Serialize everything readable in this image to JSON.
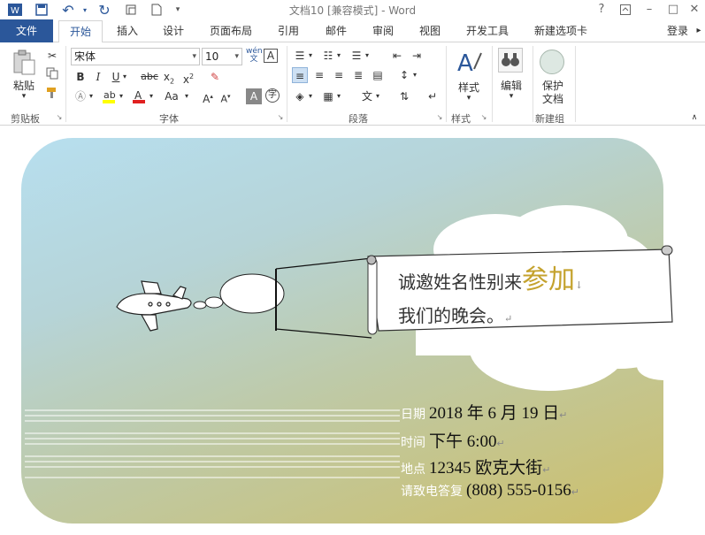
{
  "app": {
    "title": "文档10 [兼容模式] - Word",
    "help": "?",
    "login": "登录"
  },
  "tabs": {
    "file": "文件",
    "home": "开始",
    "insert": "插入",
    "design": "设计",
    "layout": "页面布局",
    "references": "引用",
    "mailings": "邮件",
    "review": "审阅",
    "view": "视图",
    "developer": "开发工具",
    "newtab": "新建选项卡"
  },
  "ribbon": {
    "clipboard": {
      "paste": "粘贴",
      "group": "剪贴板"
    },
    "font": {
      "name": "宋体",
      "size": "10",
      "group": "字体"
    },
    "paragraph": {
      "group": "段落"
    },
    "styles": {
      "label": "样式",
      "group": "样式"
    },
    "editing": {
      "label": "编辑"
    },
    "protect": {
      "label1": "保护",
      "label2": "文档",
      "group": "新建组"
    }
  },
  "document": {
    "invite_line1_pre": "诚邀姓名性别来",
    "invite_line1_hl": "参加",
    "invite_line2": "我们的晚会。",
    "details": [
      {
        "label": "日期",
        "value": "2018 年 6 月 19 日"
      },
      {
        "label": "时间",
        "value": "下午 6:00"
      },
      {
        "label": "地点",
        "value": "12345 欧克大街"
      },
      {
        "label": "请致电答复",
        "value": "(808) 555-0156"
      }
    ]
  },
  "colors": {
    "brand": "#2b579a",
    "highlight": "#c4a22d",
    "card_top": "#b7dfef",
    "card_bottom": "#cdbf6a"
  }
}
